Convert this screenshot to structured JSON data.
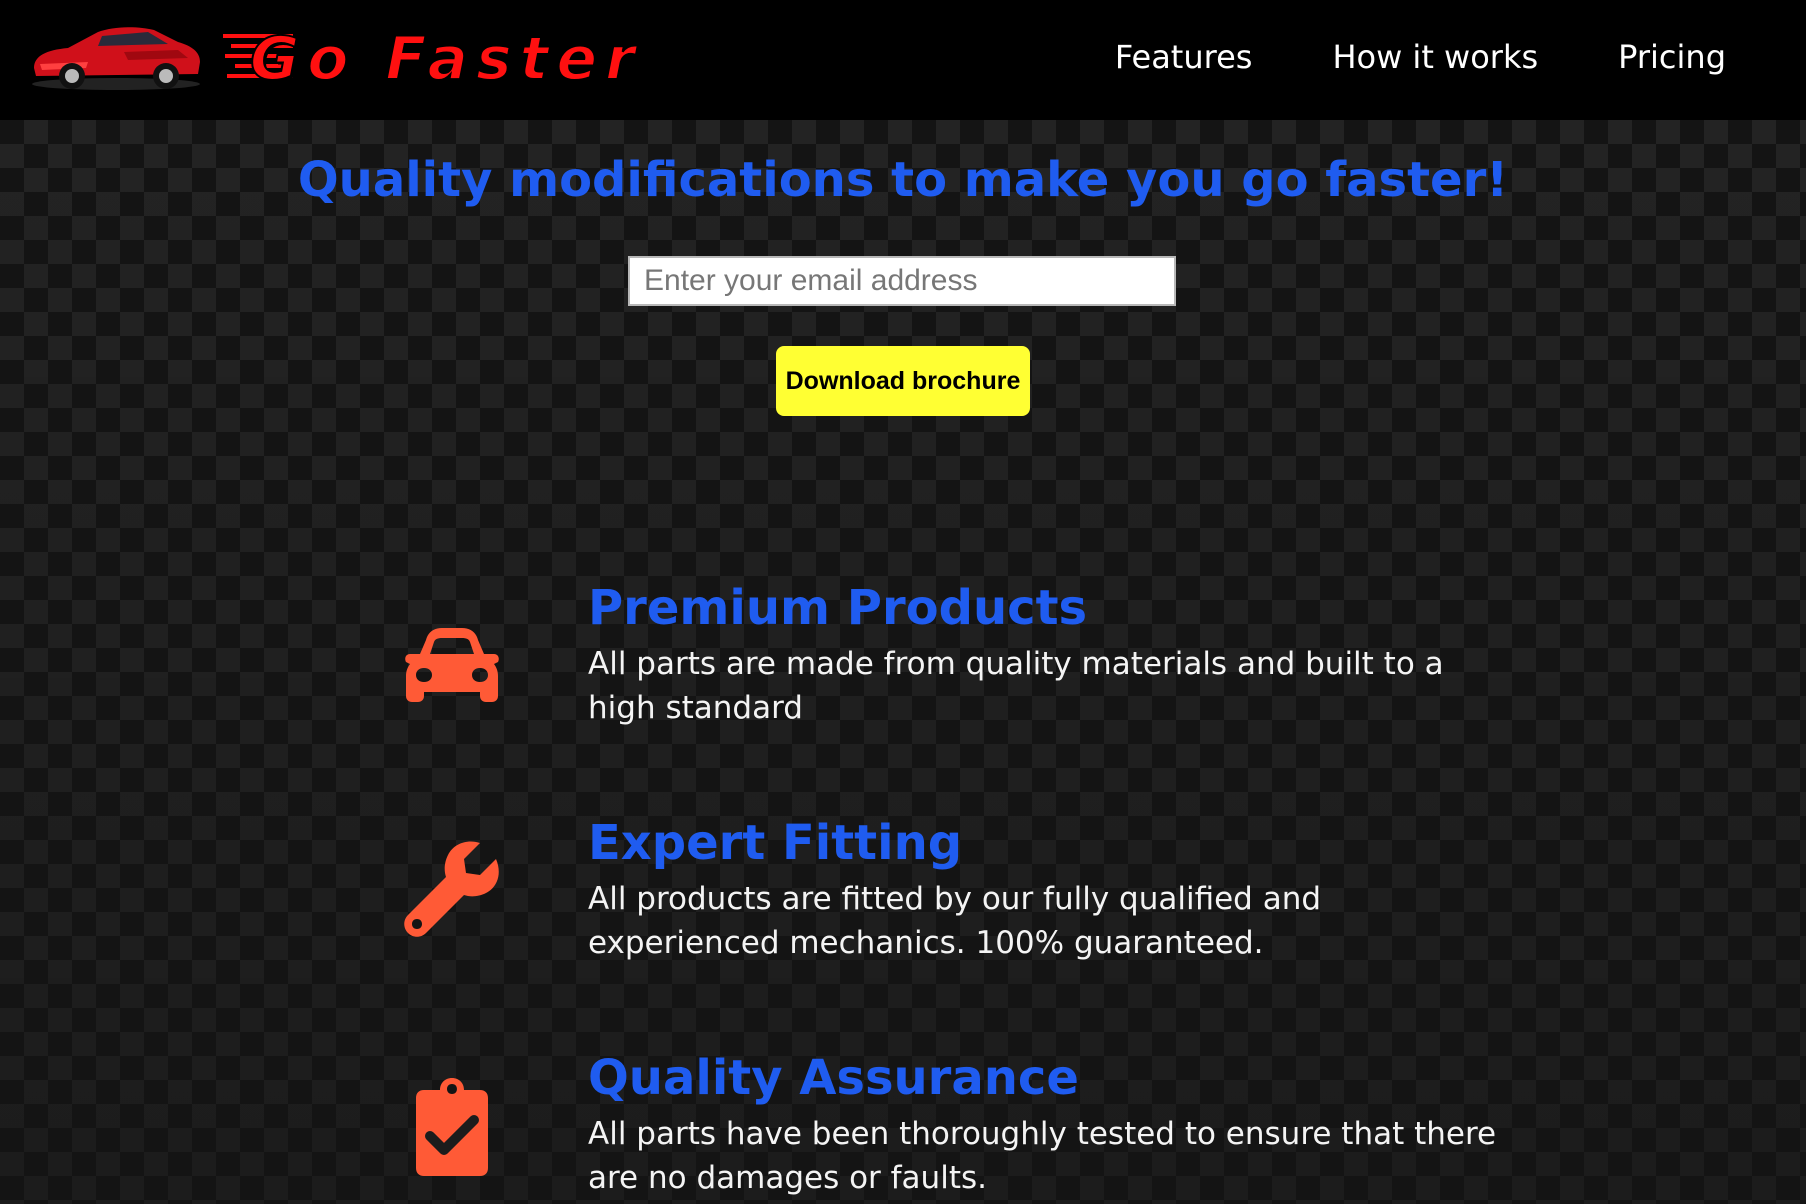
{
  "brand": {
    "name": "Go Faster",
    "logo_icon": "red-sports-car-icon",
    "accent_red": "#ff1010"
  },
  "nav": {
    "items": [
      {
        "label": "Features"
      },
      {
        "label": "How it works"
      },
      {
        "label": "Pricing"
      }
    ]
  },
  "hero": {
    "title": "Quality modifications to make you go faster!",
    "email_placeholder": "Enter your email address",
    "button_label": "Download brochure"
  },
  "features": [
    {
      "icon": "car-icon",
      "title": "Premium Products",
      "description": "All parts are made from quality materials and built to a high standard"
    },
    {
      "icon": "wrench-icon",
      "title": "Expert Fitting",
      "description": "All products are fitted by our fully qualified and experienced mechanics. 100% guaranteed."
    },
    {
      "icon": "clipboard-check-icon",
      "title": "Quality Assurance",
      "description": "All parts have been thoroughly tested to ensure that there are no damages or faults."
    }
  ],
  "colors": {
    "heading_blue": "#1f5cf0",
    "icon_orange": "#ff5a36",
    "button_yellow": "#ffff33",
    "header_bg": "#000000"
  }
}
